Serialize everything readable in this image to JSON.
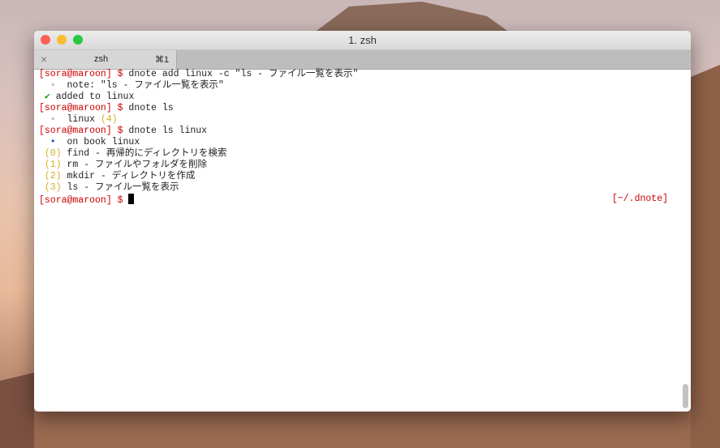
{
  "window": {
    "title": "1. zsh"
  },
  "tab": {
    "close_icon": "×",
    "label": "zsh",
    "shortcut": "⌘1"
  },
  "terminal": {
    "prompt": "[sora@maroon] $",
    "cmd1": " dnote add linux -c \"ls - ファイル一覧を表示\"",
    "out1_bullet": "  ▪",
    "out1": "  note: \"ls - ファイル一覧を表示\"",
    "out2_check": " ✔",
    "out2": " added to linux",
    "cmd2": " dnote ls",
    "out3_bullet": "  ▪",
    "out3": "  linux ",
    "out3_count": "(4)",
    "cmd3": " dnote ls linux",
    "out4_bullet": "  •",
    "out4": "  on book linux",
    "notes": [
      {
        "idx": " (0)",
        "text": " find - 再帰的にディレクトリを検索"
      },
      {
        "idx": " (1)",
        "text": " rm - ファイルやフォルダを削除"
      },
      {
        "idx": " (2)",
        "text": " mkdir - ディレクトリを作成"
      },
      {
        "idx": " (3)",
        "text": " ls - ファイル一覧を表示"
      }
    ],
    "right_prompt": "[~/.dnote]"
  }
}
